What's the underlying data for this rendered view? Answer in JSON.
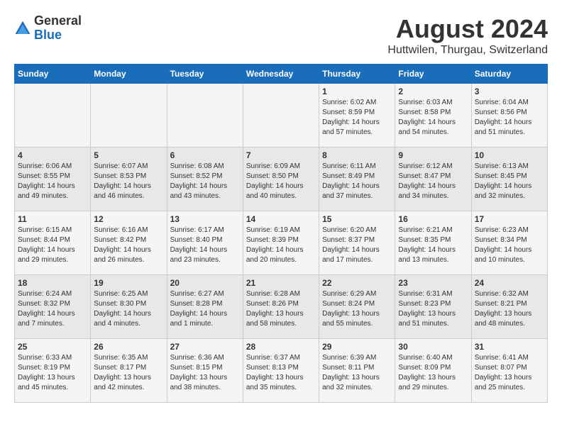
{
  "header": {
    "logo": {
      "line1": "General",
      "line2": "Blue"
    },
    "title": "August 2024",
    "location": "Huttwilen, Thurgau, Switzerland"
  },
  "weekdays": [
    "Sunday",
    "Monday",
    "Tuesday",
    "Wednesday",
    "Thursday",
    "Friday",
    "Saturday"
  ],
  "weeks": [
    [
      {
        "day": "",
        "info": ""
      },
      {
        "day": "",
        "info": ""
      },
      {
        "day": "",
        "info": ""
      },
      {
        "day": "",
        "info": ""
      },
      {
        "day": "1",
        "info": "Sunrise: 6:02 AM\nSunset: 8:59 PM\nDaylight: 14 hours\nand 57 minutes."
      },
      {
        "day": "2",
        "info": "Sunrise: 6:03 AM\nSunset: 8:58 PM\nDaylight: 14 hours\nand 54 minutes."
      },
      {
        "day": "3",
        "info": "Sunrise: 6:04 AM\nSunset: 8:56 PM\nDaylight: 14 hours\nand 51 minutes."
      }
    ],
    [
      {
        "day": "4",
        "info": "Sunrise: 6:06 AM\nSunset: 8:55 PM\nDaylight: 14 hours\nand 49 minutes."
      },
      {
        "day": "5",
        "info": "Sunrise: 6:07 AM\nSunset: 8:53 PM\nDaylight: 14 hours\nand 46 minutes."
      },
      {
        "day": "6",
        "info": "Sunrise: 6:08 AM\nSunset: 8:52 PM\nDaylight: 14 hours\nand 43 minutes."
      },
      {
        "day": "7",
        "info": "Sunrise: 6:09 AM\nSunset: 8:50 PM\nDaylight: 14 hours\nand 40 minutes."
      },
      {
        "day": "8",
        "info": "Sunrise: 6:11 AM\nSunset: 8:49 PM\nDaylight: 14 hours\nand 37 minutes."
      },
      {
        "day": "9",
        "info": "Sunrise: 6:12 AM\nSunset: 8:47 PM\nDaylight: 14 hours\nand 34 minutes."
      },
      {
        "day": "10",
        "info": "Sunrise: 6:13 AM\nSunset: 8:45 PM\nDaylight: 14 hours\nand 32 minutes."
      }
    ],
    [
      {
        "day": "11",
        "info": "Sunrise: 6:15 AM\nSunset: 8:44 PM\nDaylight: 14 hours\nand 29 minutes."
      },
      {
        "day": "12",
        "info": "Sunrise: 6:16 AM\nSunset: 8:42 PM\nDaylight: 14 hours\nand 26 minutes."
      },
      {
        "day": "13",
        "info": "Sunrise: 6:17 AM\nSunset: 8:40 PM\nDaylight: 14 hours\nand 23 minutes."
      },
      {
        "day": "14",
        "info": "Sunrise: 6:19 AM\nSunset: 8:39 PM\nDaylight: 14 hours\nand 20 minutes."
      },
      {
        "day": "15",
        "info": "Sunrise: 6:20 AM\nSunset: 8:37 PM\nDaylight: 14 hours\nand 17 minutes."
      },
      {
        "day": "16",
        "info": "Sunrise: 6:21 AM\nSunset: 8:35 PM\nDaylight: 14 hours\nand 13 minutes."
      },
      {
        "day": "17",
        "info": "Sunrise: 6:23 AM\nSunset: 8:34 PM\nDaylight: 14 hours\nand 10 minutes."
      }
    ],
    [
      {
        "day": "18",
        "info": "Sunrise: 6:24 AM\nSunset: 8:32 PM\nDaylight: 14 hours\nand 7 minutes."
      },
      {
        "day": "19",
        "info": "Sunrise: 6:25 AM\nSunset: 8:30 PM\nDaylight: 14 hours\nand 4 minutes."
      },
      {
        "day": "20",
        "info": "Sunrise: 6:27 AM\nSunset: 8:28 PM\nDaylight: 14 hours\nand 1 minute."
      },
      {
        "day": "21",
        "info": "Sunrise: 6:28 AM\nSunset: 8:26 PM\nDaylight: 13 hours\nand 58 minutes."
      },
      {
        "day": "22",
        "info": "Sunrise: 6:29 AM\nSunset: 8:24 PM\nDaylight: 13 hours\nand 55 minutes."
      },
      {
        "day": "23",
        "info": "Sunrise: 6:31 AM\nSunset: 8:23 PM\nDaylight: 13 hours\nand 51 minutes."
      },
      {
        "day": "24",
        "info": "Sunrise: 6:32 AM\nSunset: 8:21 PM\nDaylight: 13 hours\nand 48 minutes."
      }
    ],
    [
      {
        "day": "25",
        "info": "Sunrise: 6:33 AM\nSunset: 8:19 PM\nDaylight: 13 hours\nand 45 minutes."
      },
      {
        "day": "26",
        "info": "Sunrise: 6:35 AM\nSunset: 8:17 PM\nDaylight: 13 hours\nand 42 minutes."
      },
      {
        "day": "27",
        "info": "Sunrise: 6:36 AM\nSunset: 8:15 PM\nDaylight: 13 hours\nand 38 minutes."
      },
      {
        "day": "28",
        "info": "Sunrise: 6:37 AM\nSunset: 8:13 PM\nDaylight: 13 hours\nand 35 minutes."
      },
      {
        "day": "29",
        "info": "Sunrise: 6:39 AM\nSunset: 8:11 PM\nDaylight: 13 hours\nand 32 minutes."
      },
      {
        "day": "30",
        "info": "Sunrise: 6:40 AM\nSunset: 8:09 PM\nDaylight: 13 hours\nand 29 minutes."
      },
      {
        "day": "31",
        "info": "Sunrise: 6:41 AM\nSunset: 8:07 PM\nDaylight: 13 hours\nand 25 minutes."
      }
    ]
  ]
}
